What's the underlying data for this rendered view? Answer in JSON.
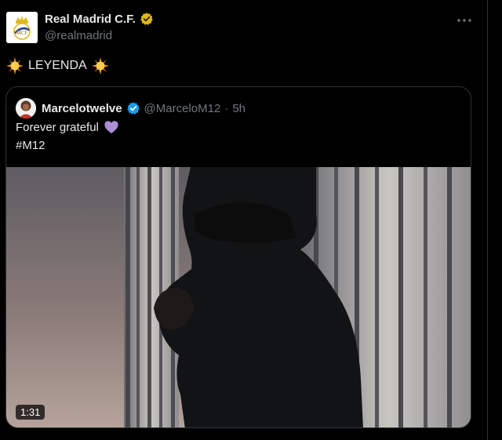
{
  "tweet": {
    "author": {
      "display_name": "Real Madrid C.F.",
      "handle": "@realmadrid",
      "verified_badge": "gold-check-badge",
      "avatar": "real-madrid-crest"
    },
    "text": "LEYENDA",
    "text_emoji": "sun-emoji",
    "more_icon": "more-horizontal-icon"
  },
  "quote": {
    "author": {
      "display_name": "Marcelotwelve",
      "handle": "@MarceloM12",
      "separator": "·",
      "time": "5h",
      "verified_badge": "blue-check-badge"
    },
    "line1": "Forever grateful",
    "line1_emoji": "purple-heart-emoji",
    "line2": "#M12",
    "video": {
      "duration": "1:31"
    }
  },
  "colors": {
    "background": "#000000",
    "text_primary": "#e7e9ea",
    "text_secondary": "#71767b",
    "border": "#2f3336",
    "gold_badge": "#e2b719",
    "blue_badge": "#1d9bf0",
    "purple_heart": "#aa8ed6"
  }
}
